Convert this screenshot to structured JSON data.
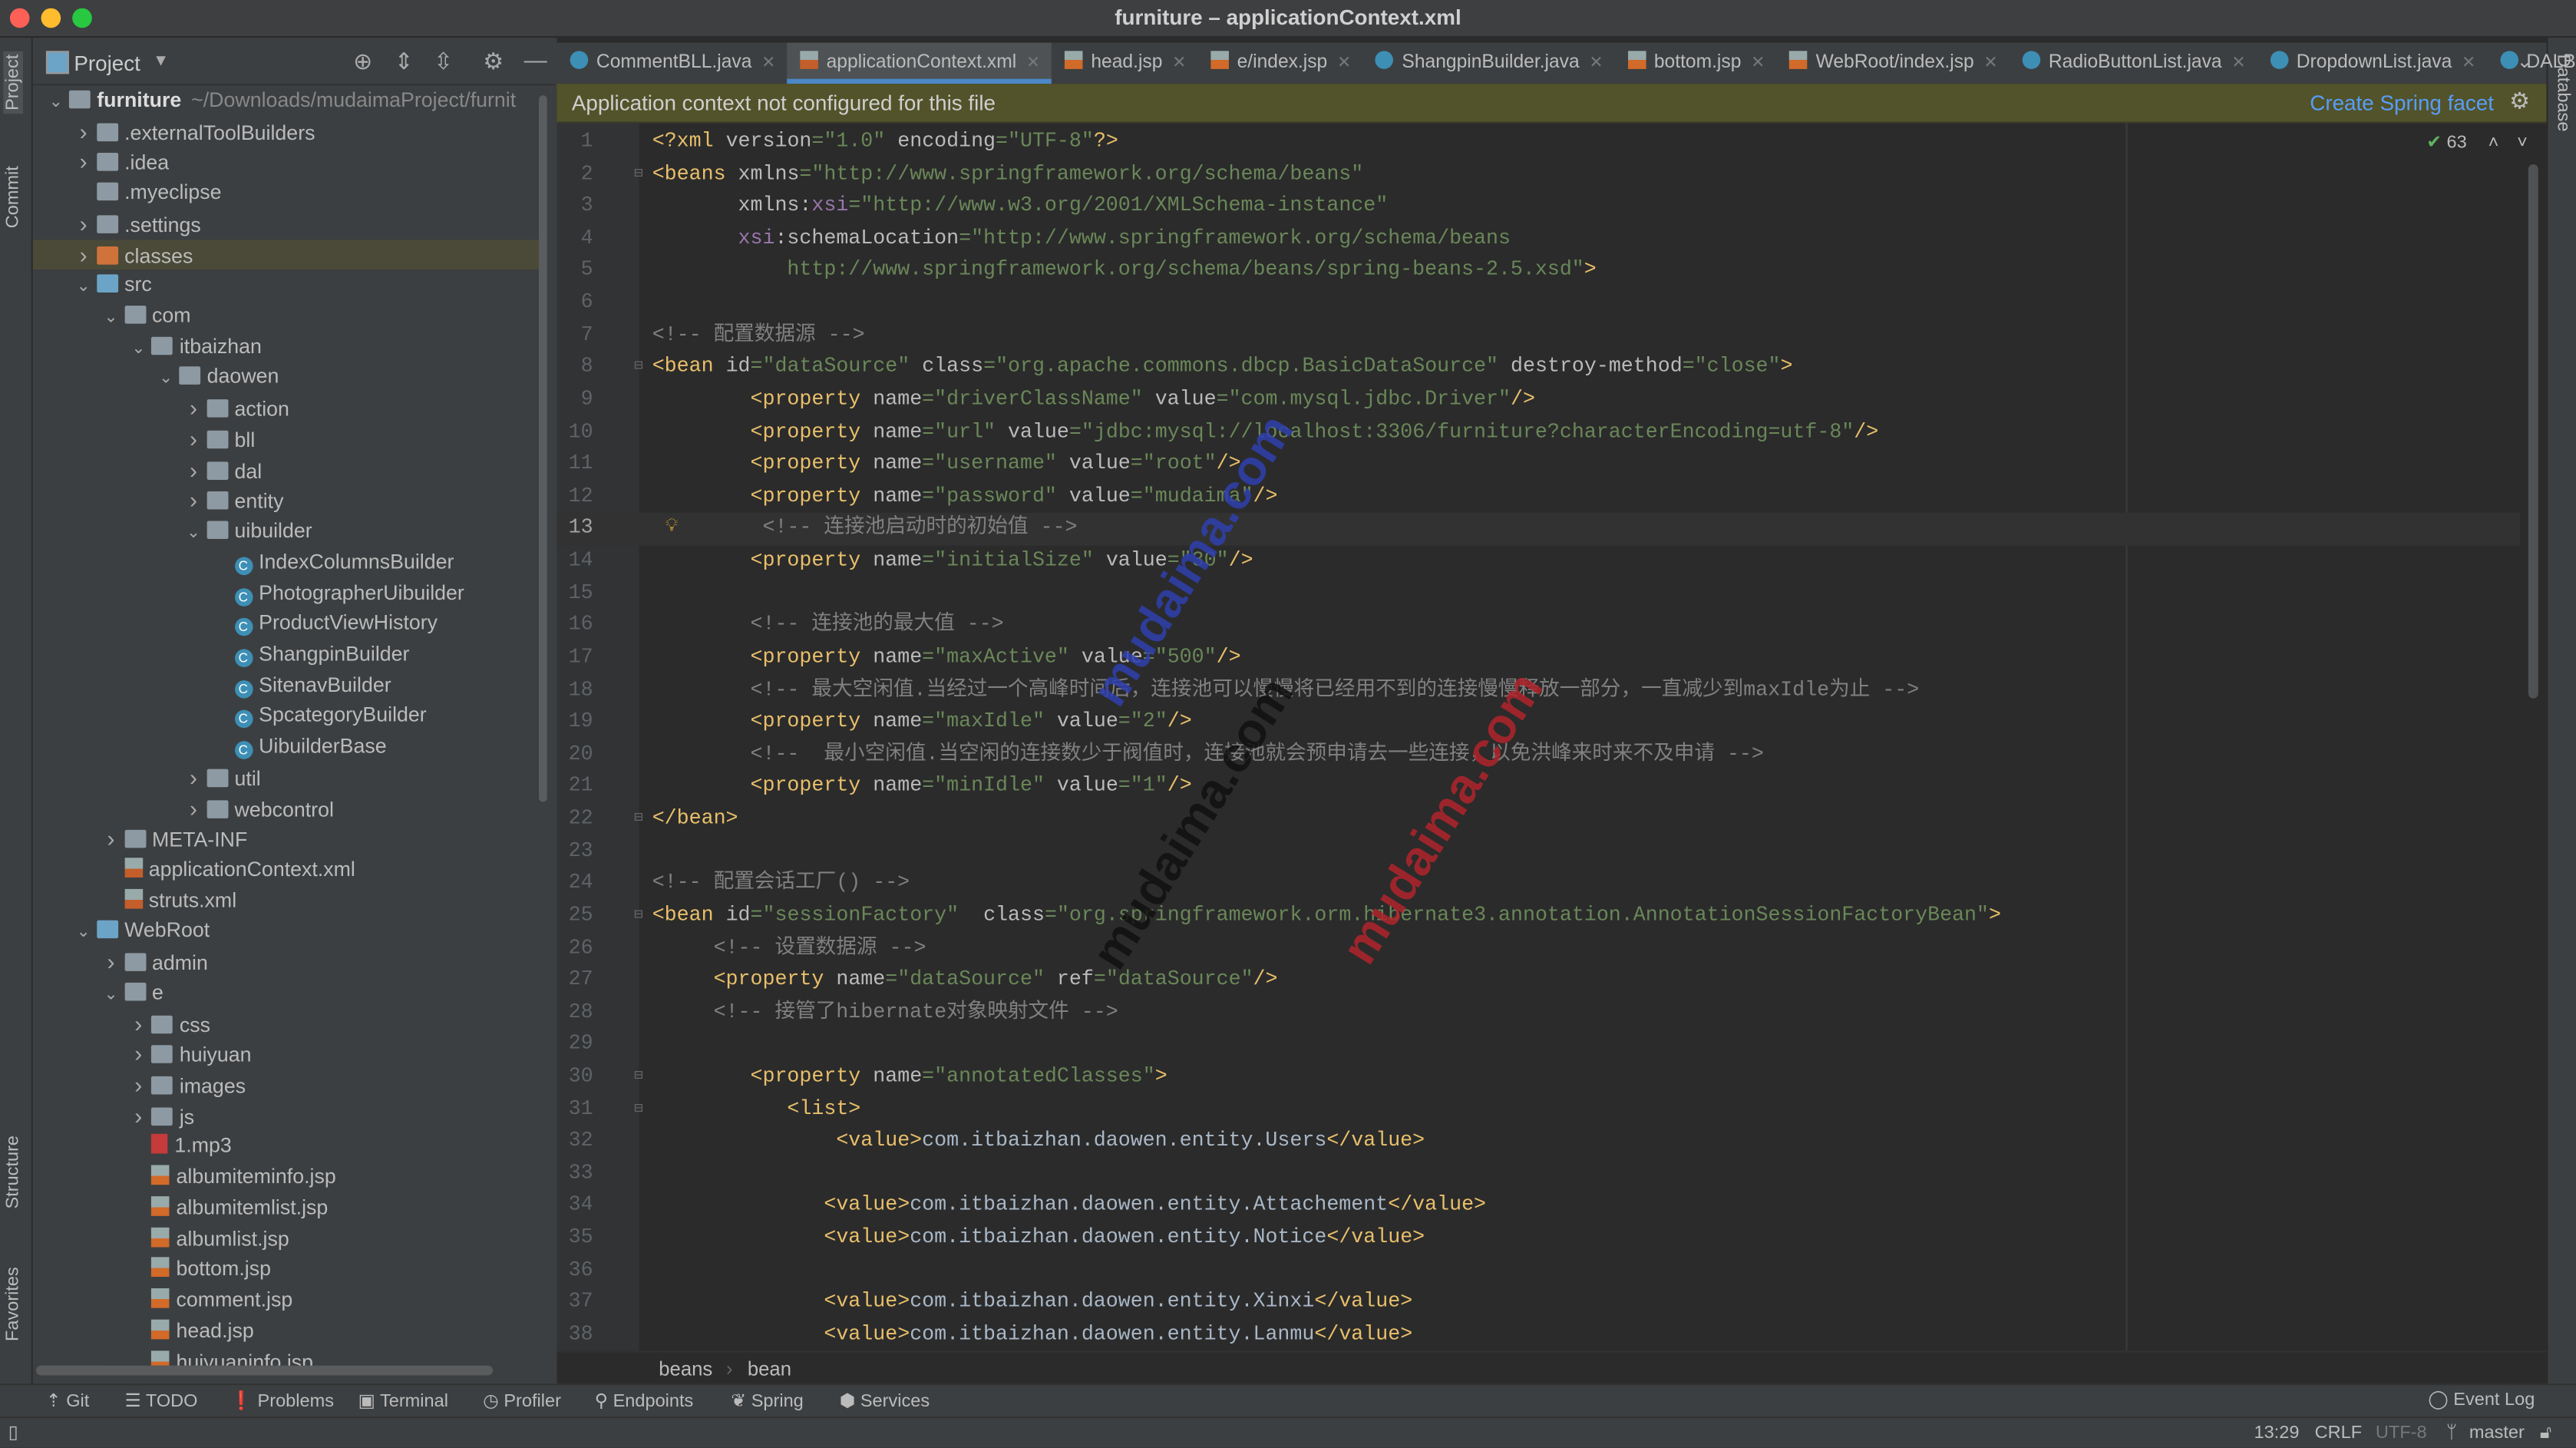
{
  "window": {
    "title": "furniture – applicationContext.xml"
  },
  "left_stripe": {
    "project": "Project",
    "commit": "Commit",
    "structure": "Structure",
    "favorites": "Favorites"
  },
  "right_stripe": {
    "database": "Database"
  },
  "project_panel": {
    "title": "Project",
    "tree": [
      {
        "level": 0,
        "name": "furniture",
        "extra": "~/Downloads/mudaimaProject/furnit",
        "state": "expanded",
        "icon": "module-folder",
        "bold": true
      },
      {
        "level": 1,
        "name": ".externalToolBuilders",
        "state": "collapsed",
        "icon": "folder"
      },
      {
        "level": 1,
        "name": ".idea",
        "state": "collapsed",
        "icon": "folder"
      },
      {
        "level": 1,
        "name": ".myeclipse",
        "state": "none",
        "icon": "folder"
      },
      {
        "level": 1,
        "name": ".settings",
        "state": "collapsed",
        "icon": "folder"
      },
      {
        "level": 1,
        "name": "classes",
        "state": "collapsed",
        "icon": "excluded-folder",
        "selected": true
      },
      {
        "level": 1,
        "name": "src",
        "state": "expanded",
        "icon": "source-folder"
      },
      {
        "level": 2,
        "name": "com",
        "state": "expanded",
        "icon": "package"
      },
      {
        "level": 3,
        "name": "itbaizhan",
        "state": "expanded",
        "icon": "package"
      },
      {
        "level": 4,
        "name": "daowen",
        "state": "expanded",
        "icon": "package"
      },
      {
        "level": 5,
        "name": "action",
        "state": "collapsed",
        "icon": "package"
      },
      {
        "level": 5,
        "name": "bll",
        "state": "collapsed",
        "icon": "package"
      },
      {
        "level": 5,
        "name": "dal",
        "state": "collapsed",
        "icon": "package"
      },
      {
        "level": 5,
        "name": "entity",
        "state": "collapsed",
        "icon": "package"
      },
      {
        "level": 5,
        "name": "uibuilder",
        "state": "expanded",
        "icon": "package"
      },
      {
        "level": 6,
        "name": "IndexColumnsBuilder",
        "state": "none",
        "icon": "class"
      },
      {
        "level": 6,
        "name": "PhotographerUibuilder",
        "state": "none",
        "icon": "class"
      },
      {
        "level": 6,
        "name": "ProductViewHistory",
        "state": "none",
        "icon": "class"
      },
      {
        "level": 6,
        "name": "ShangpinBuilder",
        "state": "none",
        "icon": "class"
      },
      {
        "level": 6,
        "name": "SitenavBuilder",
        "state": "none",
        "icon": "class"
      },
      {
        "level": 6,
        "name": "SpcategoryBuilder",
        "state": "none",
        "icon": "class"
      },
      {
        "level": 6,
        "name": "UibuilderBase",
        "state": "none",
        "icon": "class"
      },
      {
        "level": 5,
        "name": "util",
        "state": "collapsed",
        "icon": "package"
      },
      {
        "level": 5,
        "name": "webcontrol",
        "state": "collapsed",
        "icon": "package"
      },
      {
        "level": 2,
        "name": "META-INF",
        "state": "collapsed",
        "icon": "folder"
      },
      {
        "level": 2,
        "name": "applicationContext.xml",
        "state": "none",
        "icon": "xml"
      },
      {
        "level": 2,
        "name": "struts.xml",
        "state": "none",
        "icon": "xml"
      },
      {
        "level": 1,
        "name": "WebRoot",
        "state": "expanded",
        "icon": "web-folder"
      },
      {
        "level": 2,
        "name": "admin",
        "state": "collapsed",
        "icon": "folder"
      },
      {
        "level": 2,
        "name": "e",
        "state": "expanded",
        "icon": "folder"
      },
      {
        "level": 3,
        "name": "css",
        "state": "collapsed",
        "icon": "folder"
      },
      {
        "level": 3,
        "name": "huiyuan",
        "state": "collapsed",
        "icon": "folder"
      },
      {
        "level": 3,
        "name": "images",
        "state": "collapsed",
        "icon": "folder"
      },
      {
        "level": 3,
        "name": "js",
        "state": "collapsed",
        "icon": "folder"
      },
      {
        "level": 3,
        "name": "1.mp3",
        "state": "none",
        "icon": "audio"
      },
      {
        "level": 3,
        "name": "albumiteminfo.jsp",
        "state": "none",
        "icon": "jsp"
      },
      {
        "level": 3,
        "name": "albumitemlist.jsp",
        "state": "none",
        "icon": "jsp"
      },
      {
        "level": 3,
        "name": "albumlist.jsp",
        "state": "none",
        "icon": "jsp"
      },
      {
        "level": 3,
        "name": "bottom.jsp",
        "state": "none",
        "icon": "jsp"
      },
      {
        "level": 3,
        "name": "comment.jsp",
        "state": "none",
        "icon": "jsp"
      },
      {
        "level": 3,
        "name": "head.jsp",
        "state": "none",
        "icon": "jsp"
      },
      {
        "level": 3,
        "name": "huiyuaninfo.jsp",
        "state": "none",
        "icon": "jsp"
      }
    ]
  },
  "tabs": [
    {
      "label": "CommentBLL.java",
      "icon": "class"
    },
    {
      "label": "applicationContext.xml",
      "icon": "spring-xml",
      "active": true
    },
    {
      "label": "head.jsp",
      "icon": "jsp"
    },
    {
      "label": "e/index.jsp",
      "icon": "jsp"
    },
    {
      "label": "ShangpinBuilder.java",
      "icon": "class"
    },
    {
      "label": "bottom.jsp",
      "icon": "jsp"
    },
    {
      "label": "WebRoot/index.jsp",
      "icon": "jsp"
    },
    {
      "label": "RadioButtonList.java",
      "icon": "class"
    },
    {
      "label": "DropdownList.java",
      "icon": "class"
    },
    {
      "label": "DALB",
      "icon": "class"
    }
  ],
  "banner": {
    "message": "Application context not configured for this file",
    "action": "Create Spring facet"
  },
  "inspection": {
    "count": "63"
  },
  "editor": {
    "current_line": 13,
    "fold_lines": [
      2,
      8,
      22,
      25,
      30,
      31
    ],
    "bulb_line": 13,
    "lines": [
      [
        [
          "tag",
          "<?xml "
        ],
        [
          "attr",
          "version"
        ],
        [
          "val",
          "=\"1.0\" "
        ],
        [
          "attr",
          "encoding"
        ],
        [
          "val",
          "=\"UTF-8\""
        ],
        [
          "tag",
          "?>"
        ]
      ],
      [
        [
          "tag",
          "<beans "
        ],
        [
          "attr",
          "xmlns"
        ],
        [
          "val",
          "=\"http://www.springframework.org/schema/beans\""
        ]
      ],
      [
        [
          "attr",
          "       xmlns:"
        ],
        [
          "ns",
          "xsi"
        ],
        [
          "val",
          "=\"http://www.w3.org/2001/XMLSchema-instance\""
        ]
      ],
      [
        [
          "ns",
          "       xsi"
        ],
        [
          "attr",
          ":schemaLocation"
        ],
        [
          "val",
          "=\"http://www.springframework.org/schema/beans"
        ]
      ],
      [
        [
          "val",
          "           http://www.springframework.org/schema/beans/spring-beans-2.5.xsd\""
        ],
        [
          "tag",
          ">"
        ]
      ],
      [],
      [
        [
          "com",
          "<!-- 配置数据源 -->"
        ]
      ],
      [
        [
          "tag",
          "<bean "
        ],
        [
          "attr",
          "id"
        ],
        [
          "val",
          "=\"dataSource\" "
        ],
        [
          "attr",
          "class"
        ],
        [
          "val",
          "=\"org.apache.commons.dbcp.BasicDataSource\" "
        ],
        [
          "attr",
          "destroy-method"
        ],
        [
          "val",
          "=\"close\""
        ],
        [
          "tag",
          ">"
        ]
      ],
      [
        [
          "tag",
          "        <property "
        ],
        [
          "attr",
          "name"
        ],
        [
          "val",
          "=\"driverClassName\" "
        ],
        [
          "attr",
          "value"
        ],
        [
          "val",
          "=\"com.mysql.jdbc.Driver\""
        ],
        [
          "tag",
          "/>"
        ]
      ],
      [
        [
          "tag",
          "        <property "
        ],
        [
          "attr",
          "name"
        ],
        [
          "val",
          "=\"url\" "
        ],
        [
          "attr",
          "value"
        ],
        [
          "val",
          "=\"jdbc:mysql://localhost:3306/furniture?characterEncoding=utf-8\""
        ],
        [
          "tag",
          "/>"
        ]
      ],
      [
        [
          "tag",
          "        <property "
        ],
        [
          "attr",
          "name"
        ],
        [
          "val",
          "=\"username\" "
        ],
        [
          "attr",
          "value"
        ],
        [
          "val",
          "=\"root\""
        ],
        [
          "tag",
          "/>"
        ]
      ],
      [
        [
          "tag",
          "        <property "
        ],
        [
          "attr",
          "name"
        ],
        [
          "val",
          "=\"password\" "
        ],
        [
          "attr",
          "value"
        ],
        [
          "val",
          "=\"mudaima\""
        ],
        [
          "tag",
          "/>"
        ]
      ],
      [
        [
          "com",
          "         <!-- 连接池启动时的初始值 -->"
        ]
      ],
      [
        [
          "tag",
          "        <property "
        ],
        [
          "attr",
          "name"
        ],
        [
          "val",
          "=\"initialSize\" "
        ],
        [
          "attr",
          "value"
        ],
        [
          "val",
          "=\"30\""
        ],
        [
          "tag",
          "/>"
        ]
      ],
      [],
      [
        [
          "com",
          "        <!-- 连接池的最大值 -->"
        ]
      ],
      [
        [
          "tag",
          "        <property "
        ],
        [
          "attr",
          "name"
        ],
        [
          "val",
          "=\"maxActive\" "
        ],
        [
          "attr",
          "value"
        ],
        [
          "val",
          "=\"500\""
        ],
        [
          "tag",
          "/>"
        ]
      ],
      [
        [
          "com",
          "        <!-- 最大空闲值.当经过一个高峰时间后，连接池可以慢慢将已经用不到的连接慢慢释放一部分，一直减少到maxIdle为止 -->"
        ]
      ],
      [
        [
          "tag",
          "        <property "
        ],
        [
          "attr",
          "name"
        ],
        [
          "val",
          "=\"maxIdle\" "
        ],
        [
          "attr",
          "value"
        ],
        [
          "val",
          "=\"2\""
        ],
        [
          "tag",
          "/>"
        ]
      ],
      [
        [
          "com",
          "        <!--  最小空闲值.当空闲的连接数少于阀值时，连接池就会预申请去一些连接，以免洪峰来时来不及申请 -->"
        ]
      ],
      [
        [
          "tag",
          "        <property "
        ],
        [
          "attr",
          "name"
        ],
        [
          "val",
          "=\"minIdle\" "
        ],
        [
          "attr",
          "value"
        ],
        [
          "val",
          "=\"1\""
        ],
        [
          "tag",
          "/>"
        ]
      ],
      [
        [
          "tag",
          "</bean>"
        ]
      ],
      [],
      [
        [
          "com",
          "<!-- 配置会话工厂() -->"
        ]
      ],
      [
        [
          "tag",
          "<bean "
        ],
        [
          "attr",
          "id"
        ],
        [
          "val",
          "=\"sessionFactory\"  "
        ],
        [
          "attr",
          "class"
        ],
        [
          "val",
          "=\"org.springframework.orm.hibernate3.annotation.AnnotationSessionFactoryBean\""
        ],
        [
          "tag",
          ">"
        ]
      ],
      [
        [
          "com",
          "     <!-- 设置数据源 -->"
        ]
      ],
      [
        [
          "tag",
          "     <property "
        ],
        [
          "attr",
          "name"
        ],
        [
          "val",
          "=\"dataSource\" "
        ],
        [
          "attr",
          "ref"
        ],
        [
          "val",
          "=\"dataSource\""
        ],
        [
          "tag",
          "/>"
        ]
      ],
      [
        [
          "com",
          "     <!-- 接管了hibernate对象映射文件 -->"
        ]
      ],
      [],
      [
        [
          "tag",
          "        <property "
        ],
        [
          "attr",
          "name"
        ],
        [
          "val",
          "=\"annotatedClasses\""
        ],
        [
          "tag",
          ">"
        ]
      ],
      [
        [
          "tag",
          "           <list>"
        ]
      ],
      [
        [
          "tag",
          "               <value>"
        ],
        [
          "txt",
          "com.itbaizhan.daowen.entity.Users"
        ],
        [
          "tag",
          "</value>"
        ]
      ],
      [],
      [
        [
          "tag",
          "              <value>"
        ],
        [
          "txt",
          "com.itbaizhan.daowen.entity.Attachement"
        ],
        [
          "tag",
          "</value>"
        ]
      ],
      [
        [
          "tag",
          "              <value>"
        ],
        [
          "txt",
          "com.itbaizhan.daowen.entity.Notice"
        ],
        [
          "tag",
          "</value>"
        ]
      ],
      [],
      [
        [
          "tag",
          "              <value>"
        ],
        [
          "txt",
          "com.itbaizhan.daowen.entity.Xinxi"
        ],
        [
          "tag",
          "</value>"
        ]
      ],
      [
        [
          "tag",
          "              <value>"
        ],
        [
          "txt",
          "com.itbaizhan.daowen.entity.Lanmu"
        ],
        [
          "tag",
          "</value>"
        ]
      ]
    ]
  },
  "breadcrumb": [
    "beans",
    "bean"
  ],
  "bottom_tools": [
    {
      "label": "Git",
      "icon": "git-icon"
    },
    {
      "label": "TODO",
      "icon": "todo-icon"
    },
    {
      "label": "Problems",
      "icon": "problems-icon"
    },
    {
      "label": "Terminal",
      "icon": "terminal-icon"
    },
    {
      "label": "Profiler",
      "icon": "profiler-icon"
    },
    {
      "label": "Endpoints",
      "icon": "endpoints-icon"
    },
    {
      "label": "Spring",
      "icon": "spring-icon"
    },
    {
      "label": "Services",
      "icon": "services-icon"
    }
  ],
  "event_log": "Event Log",
  "status": {
    "position": "13:29",
    "line_sep": "CRLF",
    "encoding": "UTF-8",
    "branch": "master"
  },
  "watermark": "mudaima.com",
  "colors": {
    "accent": "#4a88c7",
    "banner_bg": "#52532a",
    "link": "#589df6",
    "tag": "#e8bf6a",
    "string": "#6a8759",
    "comment": "#808080"
  }
}
